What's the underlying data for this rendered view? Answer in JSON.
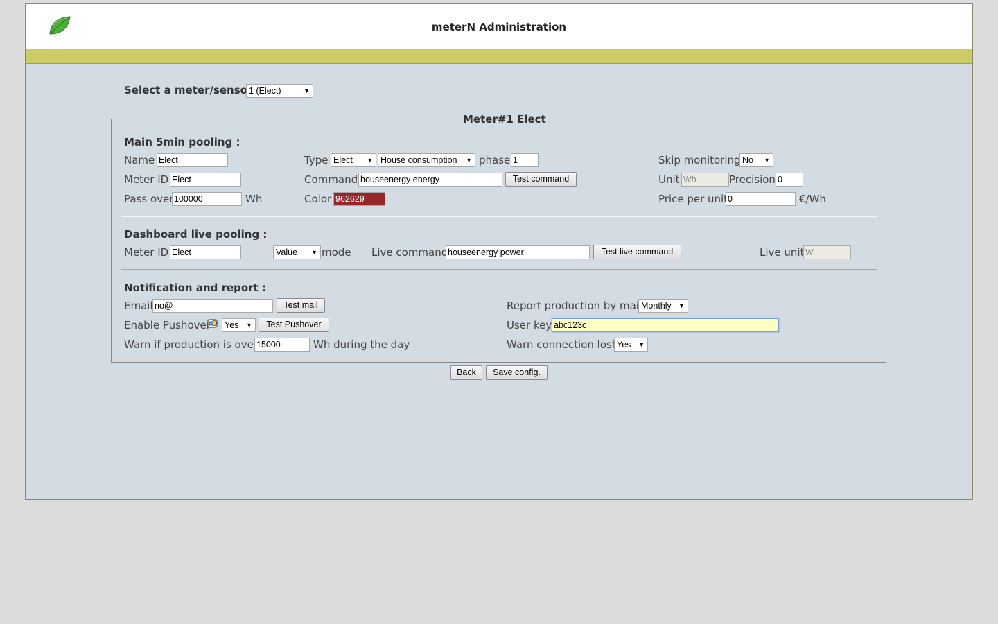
{
  "header": {
    "title": "meterN Administration",
    "logo": "leaf-logo"
  },
  "selector": {
    "label": "Select a meter/sensor :",
    "value": "1 (Elect)"
  },
  "fieldset": {
    "legend": "Meter#1 Elect"
  },
  "main": {
    "heading": "Main 5min pooling :",
    "name_label": "Name",
    "name_value": "Elect",
    "meterid_label": "Meter ID",
    "meterid_value": "Elect",
    "passover_label": "Pass over",
    "passover_value": "100000",
    "passover_unit": "Wh",
    "type_label": "Type",
    "type_value": "Elect",
    "type2_value": "House consumption",
    "phase_label": "phase",
    "phase_value": "1",
    "command_label": "Command",
    "command_value": "houseenergy energy",
    "test_command": "Test command",
    "color_label": "Color",
    "color_value": "962629",
    "color_hex": "#962629",
    "skip_label": "Skip monitoring",
    "skip_value": "No",
    "unit_label": "Unit",
    "unit_value": "Wh",
    "precision_label": "Precision",
    "precision_value": "0",
    "price_label": "Price per unit",
    "price_value": "0",
    "price_unit": "€/Wh"
  },
  "live": {
    "heading": "Dashboard live pooling :",
    "meterid_label": "Meter ID",
    "meterid_value": "Elect",
    "mode_value": "Value",
    "mode_label": "mode",
    "livecmd_label": "Live command",
    "livecmd_value": "houseenergy power",
    "test_live": "Test live command",
    "liveunit_label": "Live unit",
    "liveunit_value": "W"
  },
  "notif": {
    "heading": "Notification and report :",
    "email_label": "Email",
    "email_value": "no@",
    "test_mail": "Test mail",
    "pushover_label": "Enable Pushover",
    "pushover_value": "Yes",
    "test_pushover": "Test Pushover",
    "warn_label": "Warn if production is over",
    "warn_value": "15000",
    "warn_unit": "Wh during the day",
    "report_label": "Report production by mail",
    "report_value": "Monthly",
    "userkey_label": "User key",
    "userkey_value": "abc123c",
    "warnconn_label": "Warn connection lost",
    "warnconn_value": "Yes"
  },
  "actions": {
    "back": "Back",
    "save": "Save config."
  }
}
